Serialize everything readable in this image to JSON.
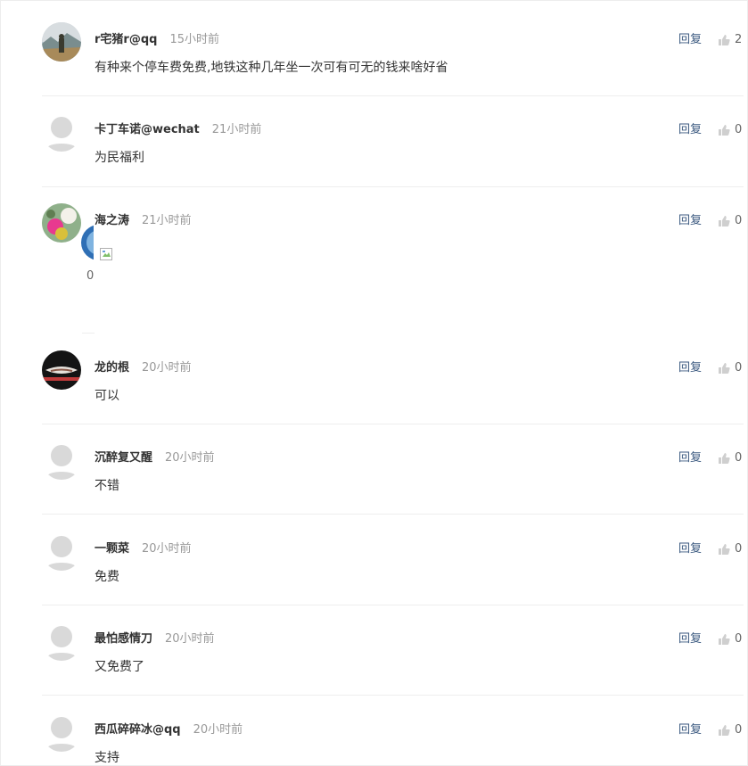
{
  "comments": [
    {
      "user": "r宅猪r@qq",
      "time": "15小时前",
      "text": "有种来个停车费免费,地铁这种几年坐一次可有可无的钱来啥好省",
      "reply": "回复",
      "likes": "2",
      "avatar": "landscape-photo-avatar"
    },
    {
      "user": "卡丁车诺@wechat",
      "time": "21小时前",
      "text": "为民福利",
      "reply": "回复",
      "likes": "0",
      "avatar": "default-avatar"
    },
    {
      "user": "海之涛",
      "time": "21小时前",
      "text": "",
      "reply": "回复",
      "likes": "0",
      "avatar": "flower-photo-avatar",
      "nested_count": "0"
    },
    {
      "user": "龙的根",
      "time": "20小时前",
      "text": "可以",
      "reply": "回复",
      "likes": "0",
      "avatar": "dark-photo-avatar"
    },
    {
      "user": "沉醉复又醒",
      "time": "20小时前",
      "text": "不错",
      "reply": "回复",
      "likes": "0",
      "avatar": "default-avatar"
    },
    {
      "user": "一颗菜",
      "time": "20小时前",
      "text": "免费",
      "reply": "回复",
      "likes": "0",
      "avatar": "default-avatar"
    },
    {
      "user": "最怕感情刀",
      "time": "20小时前",
      "text": "又免费了",
      "reply": "回复",
      "likes": "0",
      "avatar": "default-avatar"
    },
    {
      "user": "西瓜碎碎冰@qq",
      "time": "20小时前",
      "text": "支持",
      "reply": "回复",
      "likes": "0",
      "avatar": "default-avatar"
    }
  ],
  "colors": {
    "reply_link": "#3c5a80",
    "username": "#333333",
    "timestamp": "#999999",
    "divider": "#eeeeee"
  }
}
